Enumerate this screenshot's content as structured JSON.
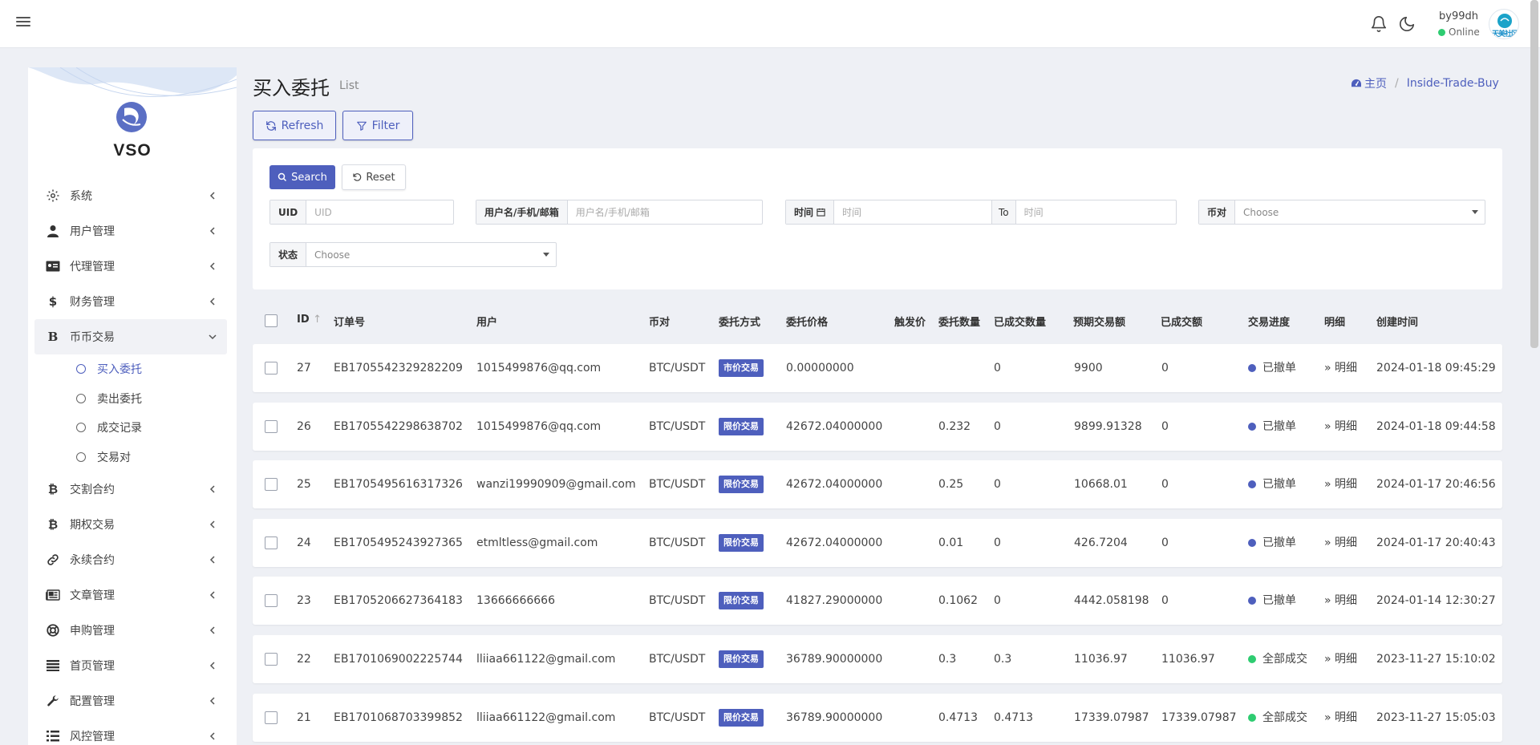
{
  "header": {
    "username": "by99dh",
    "status": "Online",
    "avatar_text": "天美社区",
    "colors": {
      "accent": "#4e5fbd",
      "online": "#2ecc71"
    }
  },
  "sidebar": {
    "logo_text": "VSO",
    "items": [
      {
        "label": "系统",
        "icon": "gear-icon"
      },
      {
        "label": "用户管理",
        "icon": "user-tie-icon"
      },
      {
        "label": "代理管理",
        "icon": "id-card-icon"
      },
      {
        "label": "财务管理",
        "icon": "dollar-icon"
      },
      {
        "label": "币币交易",
        "icon": "bitcoin-b-icon",
        "expanded": true,
        "children": [
          {
            "label": "买入委托",
            "active": true
          },
          {
            "label": "卖出委托"
          },
          {
            "label": "成交记录"
          },
          {
            "label": "交易对"
          }
        ]
      },
      {
        "label": "交割合约",
        "icon": "bitcoin-icon"
      },
      {
        "label": "期权交易",
        "icon": "bitcoin-icon"
      },
      {
        "label": "永续合约",
        "icon": "link-icon"
      },
      {
        "label": "文章管理",
        "icon": "newspaper-icon"
      },
      {
        "label": "申购管理",
        "icon": "lifebuoy-icon"
      },
      {
        "label": "首页管理",
        "icon": "list-icon"
      },
      {
        "label": "配置管理",
        "icon": "wrench-icon"
      },
      {
        "label": "风控管理",
        "icon": "list-ul-icon"
      }
    ]
  },
  "page": {
    "title": "买入委托",
    "subtitle": "List",
    "breadcrumb": {
      "home": "主页",
      "current": "Inside-Trade-Buy"
    },
    "refresh_label": "Refresh",
    "filter_label": "Filter"
  },
  "filters": {
    "search_label": "Search",
    "reset_label": "Reset",
    "uid": {
      "label": "UID",
      "placeholder": "UID"
    },
    "user": {
      "label": "用户名/手机/邮箱",
      "placeholder": "用户名/手机/邮箱"
    },
    "time": {
      "label": "时间",
      "placeholder_from": "时间",
      "to_label": "To",
      "placeholder_to": "时间"
    },
    "pair": {
      "label": "币对",
      "value": "Choose"
    },
    "state": {
      "label": "状态",
      "value": "Choose"
    }
  },
  "table": {
    "columns": [
      "ID",
      "订单号",
      "用户",
      "币对",
      "委托方式",
      "委托价格",
      "触发价",
      "委托数量",
      "已成交数量",
      "预期交易额",
      "已成交额",
      "交易进度",
      "明细",
      "创建时间"
    ],
    "detail_prefix": "»",
    "rows": [
      {
        "id": "27",
        "order": "EB1705542329282209",
        "user": "1015499876@qq.com",
        "pair": "BTC/USDT",
        "type": "市价交易",
        "price": "0.00000000",
        "trigger": "",
        "qty": "",
        "filled_qty": "0",
        "expected": "9900",
        "filled_amt": "0",
        "progress": "已撤单",
        "progress_color": "#4e5fbd",
        "detail": "明细",
        "created": "2024-01-18 09:45:29"
      },
      {
        "id": "26",
        "order": "EB1705542298638702",
        "user": "1015499876@qq.com",
        "pair": "BTC/USDT",
        "type": "限价交易",
        "price": "42672.04000000",
        "trigger": "",
        "qty": "0.232",
        "filled_qty": "0",
        "expected": "9899.91328",
        "filled_amt": "0",
        "progress": "已撤单",
        "progress_color": "#4e5fbd",
        "detail": "明细",
        "created": "2024-01-18 09:44:58"
      },
      {
        "id": "25",
        "order": "EB1705495616317326",
        "user": "wanzi19990909@gmail.com",
        "pair": "BTC/USDT",
        "type": "限价交易",
        "price": "42672.04000000",
        "trigger": "",
        "qty": "0.25",
        "filled_qty": "0",
        "expected": "10668.01",
        "filled_amt": "0",
        "progress": "已撤单",
        "progress_color": "#4e5fbd",
        "detail": "明细",
        "created": "2024-01-17 20:46:56"
      },
      {
        "id": "24",
        "order": "EB1705495243927365",
        "user": "etmltless@gmail.com",
        "pair": "BTC/USDT",
        "type": "限价交易",
        "price": "42672.04000000",
        "trigger": "",
        "qty": "0.01",
        "filled_qty": "0",
        "expected": "426.7204",
        "filled_amt": "0",
        "progress": "已撤单",
        "progress_color": "#4e5fbd",
        "detail": "明细",
        "created": "2024-01-17 20:40:43"
      },
      {
        "id": "23",
        "order": "EB1705206627364183",
        "user": "13666666666",
        "pair": "BTC/USDT",
        "type": "限价交易",
        "price": "41827.29000000",
        "trigger": "",
        "qty": "0.1062",
        "filled_qty": "0",
        "expected": "4442.058198",
        "filled_amt": "0",
        "progress": "已撤单",
        "progress_color": "#4e5fbd",
        "detail": "明细",
        "created": "2024-01-14 12:30:27"
      },
      {
        "id": "22",
        "order": "EB1701069002225744",
        "user": "lliiaa661122@gmail.com",
        "pair": "BTC/USDT",
        "type": "限价交易",
        "price": "36789.90000000",
        "trigger": "",
        "qty": "0.3",
        "filled_qty": "0.3",
        "expected": "11036.97",
        "filled_amt": "11036.97",
        "progress": "全部成交",
        "progress_color": "#2ecc71",
        "detail": "明细",
        "created": "2023-11-27 15:10:02"
      },
      {
        "id": "21",
        "order": "EB1701068703399852",
        "user": "lliiaa661122@gmail.com",
        "pair": "BTC/USDT",
        "type": "限价交易",
        "price": "36789.90000000",
        "trigger": "",
        "qty": "0.4713",
        "filled_qty": "0.4713",
        "expected": "17339.07987",
        "filled_amt": "17339.07987",
        "progress": "全部成交",
        "progress_color": "#2ecc71",
        "detail": "明细",
        "created": "2023-11-27 15:05:03"
      }
    ]
  }
}
